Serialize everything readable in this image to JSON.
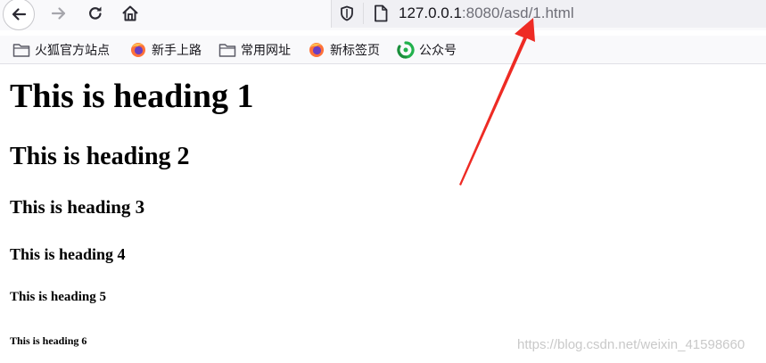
{
  "browser": {
    "nav": {
      "back_icon": "arrow-left-icon",
      "forward_icon": "arrow-right-icon",
      "reload_icon": "reload-icon",
      "home_icon": "home-icon"
    },
    "urlbar": {
      "shield_icon": "shield-icon",
      "page_icon": "page-icon",
      "host": "127.0.0.1",
      "rest": ":8080/asd/1.html"
    },
    "bookmarks": [
      {
        "label": "火狐官方站点",
        "icon": "folder-icon"
      },
      {
        "label": "新手上路",
        "icon": "firefox-icon"
      },
      {
        "label": "常用网址",
        "icon": "folder-icon"
      },
      {
        "label": "新标签页",
        "icon": "firefox-icon"
      },
      {
        "label": "公众号",
        "icon": "wechat-icon"
      }
    ]
  },
  "page": {
    "h1": "This is heading 1",
    "h2": "This is heading 2",
    "h3": "This is heading 3",
    "h4": "This is heading 4",
    "h5": "This is heading 5",
    "h6": "This is heading 6"
  },
  "watermark": "https://blog.csdn.net/weixin_41598660",
  "colors": {
    "annotation_arrow": "#ee2b24",
    "toolbar_bg": "#f9f9fb",
    "urlbar_bg": "#f0f0f4"
  }
}
